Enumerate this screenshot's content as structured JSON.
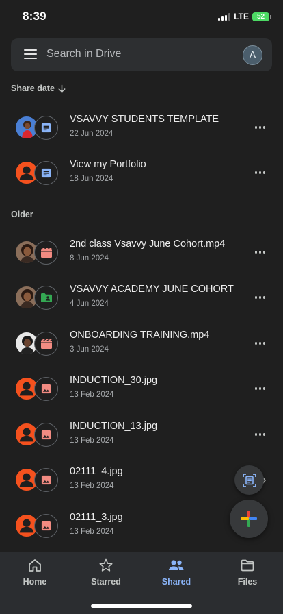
{
  "status_bar": {
    "time": "8:39",
    "network": "LTE",
    "battery": "52"
  },
  "search": {
    "placeholder": "Search in Drive",
    "account_initial": "A"
  },
  "sort": {
    "label": "Share date"
  },
  "sections": {
    "older_label": "Older"
  },
  "files": [
    {
      "title": "VSAVVY STUDENTS TEMPLATE",
      "date": "22 Jun 2024",
      "type": "doc-icon",
      "owner": "photo-red"
    },
    {
      "title": "View my Portfolio",
      "date": "18 Jun 2024",
      "type": "doc-icon",
      "owner": "generic"
    },
    {
      "title": "2nd class Vsavvy June Cohort.mp4",
      "date": "8 Jun 2024",
      "type": "video-icon",
      "owner": "photo-brown"
    },
    {
      "title": "VSAVVY ACADEMY JUNE COHORT",
      "date": "4 Jun 2024",
      "type": "shared-folder-icon",
      "owner": "photo-brown"
    },
    {
      "title": "ONBOARDING TRAINING.mp4",
      "date": "3 Jun 2024",
      "type": "video-icon",
      "owner": "photo-dark"
    },
    {
      "title": "INDUCTION_30.jpg",
      "date": "13 Feb 2024",
      "type": "image-icon",
      "owner": "generic"
    },
    {
      "title": "INDUCTION_13.jpg",
      "date": "13 Feb 2024",
      "type": "image-icon",
      "owner": "generic"
    },
    {
      "title": "02111_4.jpg",
      "date": "13 Feb 2024",
      "type": "image-icon",
      "owner": "generic"
    },
    {
      "title": "02111_3.jpg",
      "date": "13 Feb 2024",
      "type": "image-icon",
      "owner": "generic"
    }
  ],
  "nav": {
    "home": "Home",
    "starred": "Starred",
    "shared": "Shared",
    "files": "Files",
    "active": "shared"
  },
  "colors": {
    "background": "#1f1f1f",
    "accent": "#8ab4f8",
    "doc": "#8ab4f8",
    "video": "#f28b82",
    "image": "#f28b82",
    "folder": "#34a853",
    "generic_avatar": "#f4511e"
  }
}
